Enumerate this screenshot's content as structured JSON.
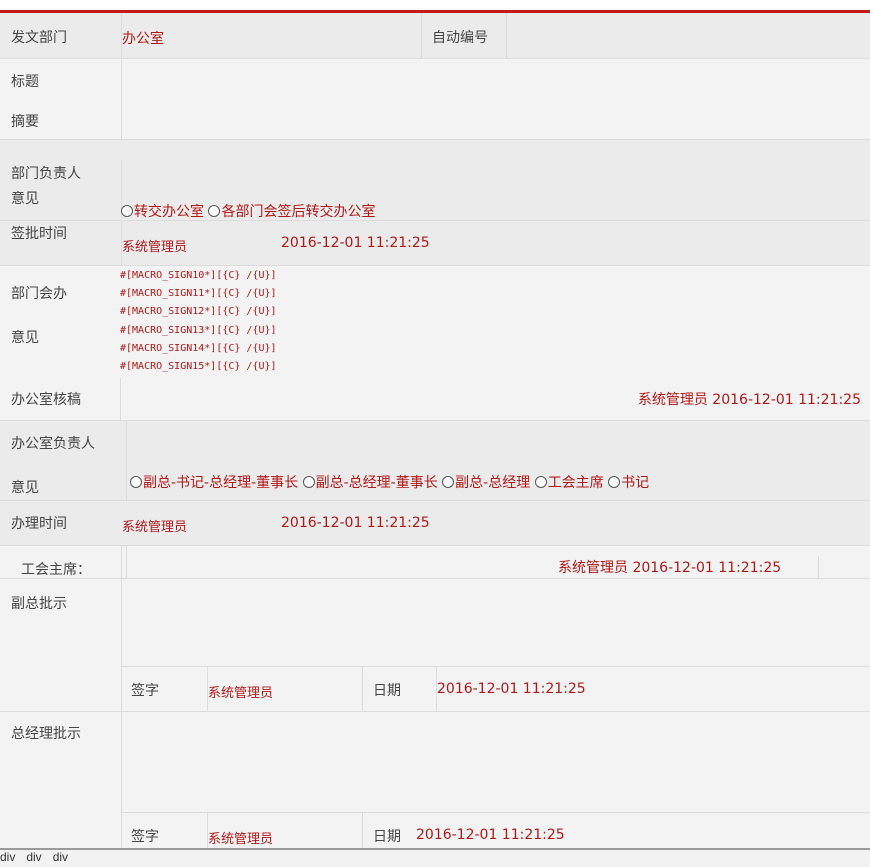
{
  "form": {
    "dept_label": "发文部门",
    "dept_value": "办公室",
    "auto_number_label": "自动编号",
    "title_label": "标题",
    "summary_label": "摘要",
    "dept_head_label_1": "部门负责人",
    "dept_head_label_2": "意见",
    "dept_head_options": [
      "转交办公室",
      "各部门会签后转交办公室"
    ],
    "sign_time_label": "签批时间",
    "sign_time_user": "系统管理员",
    "sign_time_date": "2016-12-01 11:21:25",
    "cosign_label_1": "部门会办",
    "cosign_label_2": "意见",
    "macros": [
      "#[MACRO_SIGN10*][{C} /{U}]",
      "#[MACRO_SIGN11*][{C} /{U}]",
      "#[MACRO_SIGN12*][{C} /{U}]",
      "#[MACRO_SIGN13*][{C} /{U}]",
      "#[MACRO_SIGN14*][{C} /{U}]",
      "#[MACRO_SIGN15*][{C} /{U}]"
    ],
    "office_review_label": "办公室核稿",
    "office_review_sign": "系统管理员 2016-12-01 11:21:25",
    "office_head_label_1": "办公室负责人",
    "office_head_label_2": "意见",
    "office_head_options": [
      "副总-书记-总经理-董事长",
      "副总-总经理-董事长",
      "副总-总经理",
      "工会主席",
      "书记"
    ],
    "handle_time_label": "办理时间",
    "handle_time_user": "系统管理员",
    "handle_time_date": "2016-12-01 11:21:25",
    "union_label": "工会主席：",
    "union_sign": "系统管理员 2016-12-01 11:21:25",
    "vp_label": "副总批示",
    "vp_sign_label": "签字",
    "vp_sign_user": "系统管理员",
    "vp_date_label": "日期",
    "vp_date": "2016-12-01 11:21:25",
    "gm_label": "总经理批示",
    "gm_sign_label": "签字",
    "gm_sign_user": "系统管理员",
    "gm_date_label": "日期",
    "gm_date": "2016-12-01 11:21:25"
  },
  "status_bar": [
    "div",
    "div",
    "div"
  ],
  "colors": {
    "accent": "#c41a1a",
    "text_red": "#b01818",
    "background": "#f2f2f2"
  }
}
